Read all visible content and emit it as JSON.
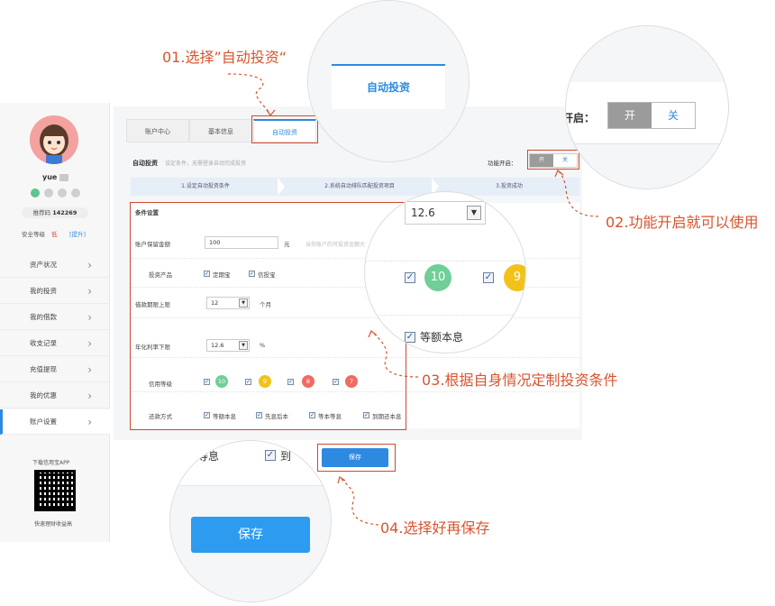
{
  "annotations": {
    "a1": "01.选择”自动投资“",
    "a2": "02.功能开启就可以使用",
    "a3": "03.根据自身情况定制投资条件",
    "a4": "04.选择好再保存"
  },
  "colors": {
    "accent": "#2d8ae0",
    "annotation": "#d8542f",
    "badge_green": "#6fcf97",
    "badge_yellow": "#f2c21b",
    "badge_red": "#ef6b63"
  },
  "sidebar": {
    "username": "yue",
    "referral_label": "推荐码",
    "referral_code": "142269",
    "security_label": "安全等级",
    "security_value": "低",
    "security_link": "[提升]",
    "menu": [
      "资产状况",
      "我的投资",
      "我的借款",
      "收支记录",
      "充值提现",
      "我的优惠",
      "账户设置"
    ],
    "app_download": "下载信用宝APP",
    "qr_caption": "快速理财收益高"
  },
  "tabs": [
    "账户中心",
    "基本信息",
    "自动投资"
  ],
  "page": {
    "title": "自动投资",
    "subtitle": "设定条件，无需登录自动完成投资",
    "function_label": "功能开启：",
    "toggle_on": "开",
    "toggle_off": "关"
  },
  "steps": [
    "1.设定自动投资条件",
    "2.系统自动排队匹配投资项目",
    "3.投资成功"
  ],
  "form": {
    "section_title": "条件设置",
    "reserve_label": "账户保留金额",
    "reserve_value": "100",
    "reserve_unit": "元",
    "reserve_hint": "当你账户的可投资金额大",
    "product_label": "投资产品",
    "products": [
      "定期宝",
      "信投宝"
    ],
    "term_label": "借款期限上限",
    "term_value": "12",
    "term_unit": "个月",
    "rate_label": "年化利率下限",
    "rate_value": "12.6",
    "rate_unit": "%",
    "credit_label": "信用等级",
    "credit_levels": [
      "10",
      "9",
      "8",
      "7"
    ],
    "repay_label": "还款方式",
    "repay_methods": [
      "等额本息",
      "先息后本",
      "等本等息",
      "到期还本息"
    ],
    "save_label": "保存"
  },
  "zoom": {
    "tab_label": "自动投资",
    "func_label_partial": "开启：",
    "toggle_on": "开",
    "toggle_off": "关",
    "rate_value": "12.6",
    "badge_a": "10",
    "badge_b": "9",
    "repay_visible": "等额本息",
    "repay_partial_1": "等息",
    "repay_partial_2": "到",
    "save_label": "保存",
    "partial_char": "句"
  }
}
